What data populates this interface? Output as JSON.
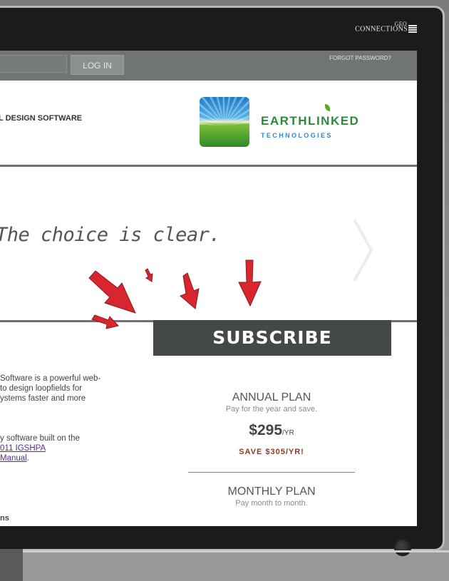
{
  "device": {
    "brand_top": "GEO",
    "brand_main": "CONNECTIONS"
  },
  "topbar": {
    "login_button": "LOG IN",
    "forgot_password": "FORGOT PASSWORD?"
  },
  "header": {
    "design_label": "L DESIGN SOFTWARE",
    "logo_name": "EARTHLINKED",
    "logo_sub": "TECHNOLOGIES"
  },
  "hero": {
    "tagline": "The choice is clear.",
    "subscribe_label": "SUBSCRIBE"
  },
  "body": {
    "intro_lines": [
      "Software is a powerful web-",
      "to design loopfields for",
      "ystems faster and more"
    ],
    "built_line": "y software built on the",
    "link1": "011 IGSHPA",
    "link2": " Manual",
    "link2_suffix": ".",
    "section_head": "ns"
  },
  "plans": {
    "annual": {
      "title": "ANNUAL PLAN",
      "subtitle": "Pay for the year and save.",
      "price": "$295",
      "period": "/YR",
      "savings": "SAVE $305/YR!"
    },
    "monthly": {
      "title": "MONTHLY PLAN",
      "subtitle": "Pay month to month."
    }
  },
  "colors": {
    "topbar": "#707474",
    "subscribe_bg": "#444849",
    "arrow_red": "#d8262e",
    "logo_green": "#2c8a3c",
    "logo_blue": "#2a8bd0",
    "savings": "#8a3a28"
  }
}
